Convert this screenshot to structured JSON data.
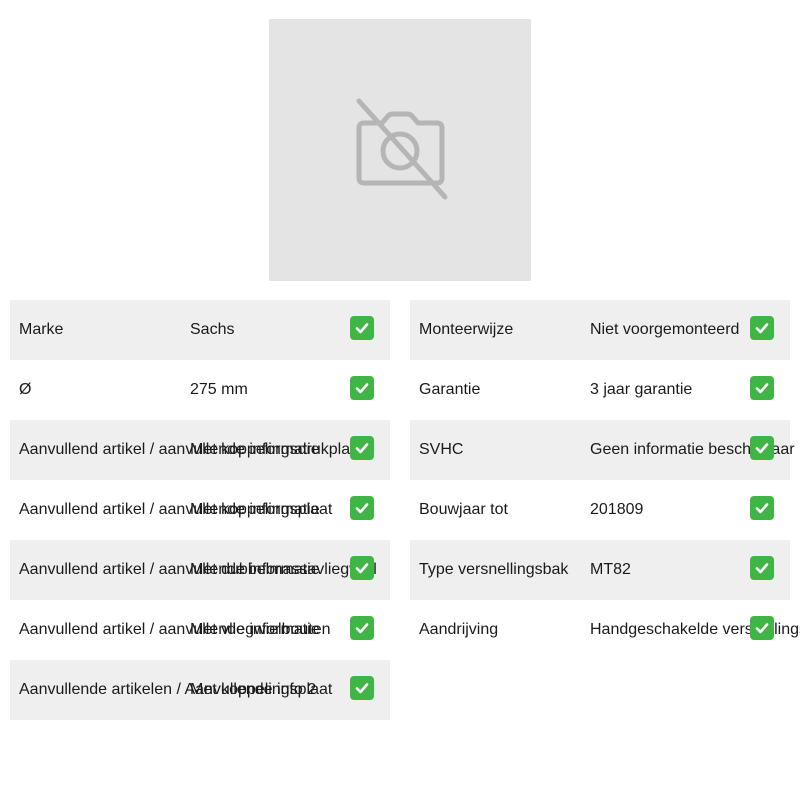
{
  "product_image": {
    "icon": "no-image-camera-icon",
    "background": "#e4e4e4"
  },
  "check_icon": {
    "icon": "check-icon",
    "color": "#3fb545"
  },
  "specs_left": [
    {
      "label": "Marke",
      "value": "Sachs"
    },
    {
      "label": "Ø",
      "value": "275 mm"
    },
    {
      "label": "Aanvullend artikel / aanvullende informatie",
      "value": "Met koppelingsdrukplaat"
    },
    {
      "label": "Aanvullend artikel / aanvullende informatie",
      "value": "Met koppelingsplaat"
    },
    {
      "label": "Aanvullend artikel / aanvullende informatie",
      "value": "Met dubbelmassavliegwiel"
    },
    {
      "label": "Aanvullend artikel / aanvullende informatie",
      "value": "Met vliegwielbouten"
    },
    {
      "label": "Aanvullende artikelen / Aanvullende info 2",
      "value": "Met koppelingsplaat"
    }
  ],
  "specs_right": [
    {
      "label": "Monteerwijze",
      "value": "Niet voorgemonteerd"
    },
    {
      "label": "Garantie",
      "value": "3 jaar garantie"
    },
    {
      "label": "SVHC",
      "value": "Geen informatie beschikbaar"
    },
    {
      "label": "Bouwjaar tot",
      "value": "201809"
    },
    {
      "label": "Type versnellingsbak",
      "value": "MT82"
    },
    {
      "label": "Aandrijving",
      "value": "Handgeschakelde versnellingsbak"
    }
  ]
}
